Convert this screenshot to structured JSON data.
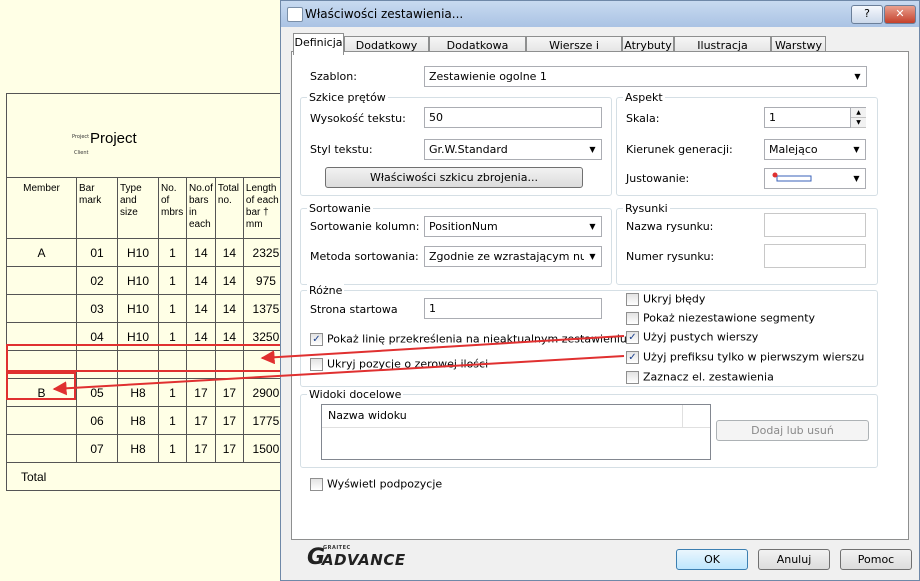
{
  "schedule": {
    "small_project_label": "Project",
    "small_client_label": "Client",
    "title": "Project",
    "headers": [
      "Member",
      "Bar mark",
      "Type and size",
      "No. of mbrs",
      "No.of bars in each",
      "Total no.",
      "Length of each bar † mm"
    ],
    "rows": [
      {
        "member": "A",
        "mark": "01",
        "type": "H10",
        "mbrs": "1",
        "bars": "14",
        "total": "14",
        "length": "2325"
      },
      {
        "member": "",
        "mark": "02",
        "type": "H10",
        "mbrs": "1",
        "bars": "14",
        "total": "14",
        "length": "975"
      },
      {
        "member": "",
        "mark": "03",
        "type": "H10",
        "mbrs": "1",
        "bars": "14",
        "total": "14",
        "length": "1375"
      },
      {
        "member": "",
        "mark": "04",
        "type": "H10",
        "mbrs": "1",
        "bars": "14",
        "total": "14",
        "length": "3250"
      },
      {
        "member": "",
        "mark": "",
        "type": "",
        "mbrs": "",
        "bars": "",
        "total": "",
        "length": ""
      },
      {
        "member": "B",
        "mark": "05",
        "type": "H8",
        "mbrs": "1",
        "bars": "17",
        "total": "17",
        "length": "2900"
      },
      {
        "member": "",
        "mark": "06",
        "type": "H8",
        "mbrs": "1",
        "bars": "17",
        "total": "17",
        "length": "1775"
      },
      {
        "member": "",
        "mark": "07",
        "type": "H8",
        "mbrs": "1",
        "bars": "17",
        "total": "17",
        "length": "1500"
      }
    ],
    "total_label": "Total"
  },
  "dialog": {
    "title": "Właściwości zestawienia...",
    "help_label": "?",
    "close_label": "✕",
    "tabs": [
      "Definicja",
      "Dodatkowy pręt",
      "Dodatkowa siatka",
      "Wiersze i kolumny",
      "Atrybuty",
      "Ilustracja kształtu",
      "Warstwy"
    ],
    "szablon_label": "Szablon:",
    "szablon_value": "Zestawienie ogolne 1",
    "szkice": {
      "title": "Szkice prętów",
      "wysokosc_label": "Wysokość tekstu:",
      "wysokosc_value": "50",
      "styl_label": "Styl tekstu:",
      "styl_value": "Gr.W.Standard",
      "button": "Właściwości szkicu zbrojenia..."
    },
    "aspekt": {
      "title": "Aspekt",
      "skala_label": "Skala:",
      "skala_value": "1",
      "kierunek_label": "Kierunek generacji:",
      "kierunek_value": "Malejąco",
      "justowanie_label": "Justowanie:"
    },
    "sortowanie": {
      "title": "Sortowanie",
      "kolumn_label": "Sortowanie kolumn:",
      "kolumn_value": "PositionNum",
      "metoda_label": "Metoda sortowania:",
      "metoda_value": "Zgodnie ze wzrastającym numere"
    },
    "rysunki": {
      "title": "Rysunki",
      "nazwa_label": "Nazwa rysunku:",
      "numer_label": "Numer rysunku:"
    },
    "rozne": {
      "title": "Różne",
      "strona_label": "Strona startowa",
      "strona_value": "1",
      "checks": [
        {
          "label": "Ukryj błędy",
          "checked": false
        },
        {
          "label": "Pokaż niezestawione segmenty",
          "checked": false
        },
        {
          "label": "Użyj pustych wierszy",
          "checked": true
        },
        {
          "label": "Użyj prefiksu tylko w pierwszym wierszu",
          "checked": true
        },
        {
          "label": "Zaznacz el. zestawienia",
          "checked": false
        }
      ],
      "left_checks": [
        {
          "label": "Pokaż linię przekreślenia na nieaktualnym zestawieniu",
          "checked": true
        },
        {
          "label": "Ukryj pozycje o zerowej ilości",
          "checked": false
        }
      ]
    },
    "widoki": {
      "title": "Widoki docelowe",
      "column": "Nazwa widoku",
      "button": "Dodaj lub usuń"
    },
    "podpozycje_label": "Wyświetl podpozycje",
    "logo_top": "GRAITEC",
    "logo_main": "ADVANCE",
    "ok": "OK",
    "cancel": "Anuluj",
    "help": "Pomoc"
  },
  "colors": {
    "annotation": "#e03030",
    "check": "#1a3f8c"
  }
}
